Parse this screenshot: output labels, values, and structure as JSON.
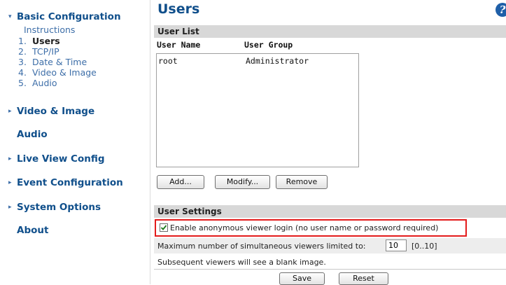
{
  "sidebar": {
    "basic_config": {
      "label": "Basic Configuration",
      "caret": "▾"
    },
    "instructions": "Instructions",
    "steps": [
      {
        "num": "1.",
        "label": "Users"
      },
      {
        "num": "2.",
        "label": "TCP/IP"
      },
      {
        "num": "3.",
        "label": "Date & Time"
      },
      {
        "num": "4.",
        "label": "Video & Image"
      },
      {
        "num": "5.",
        "label": "Audio"
      }
    ],
    "video_image": {
      "label": "Video & Image",
      "caret": "▸"
    },
    "audio": {
      "label": "Audio"
    },
    "live_view": {
      "label": "Live View Config",
      "caret": "▸"
    },
    "event_config": {
      "label": "Event Configuration",
      "caret": "▸"
    },
    "system_options": {
      "label": "System Options",
      "caret": "▸"
    },
    "about": {
      "label": "About"
    }
  },
  "main": {
    "title": "Users",
    "help_icon": "?",
    "user_list": {
      "header": "User List",
      "col_user_name": "User Name",
      "col_user_group": "User Group",
      "rows": [
        {
          "name": "root",
          "group": "Administrator"
        }
      ]
    },
    "buttons": {
      "add": "Add...",
      "modify": "Modify...",
      "remove": "Remove",
      "save": "Save",
      "reset": "Reset"
    },
    "user_settings": {
      "header": "User Settings",
      "anon_label": "Enable anonymous viewer login (no user name or password required)",
      "anon_checked": true,
      "max_viewers_label": "Maximum number of simultaneous viewers limited to:",
      "max_viewers_value": "10",
      "max_viewers_range": "[0..10]",
      "subsequent_note": "Subsequent viewers will see a blank image."
    }
  },
  "colors": {
    "nav_blue": "#104f8b",
    "sub_blue": "#3d6ea8",
    "highlight_red": "#e31b1b",
    "section_gray": "#d8d8d8"
  }
}
